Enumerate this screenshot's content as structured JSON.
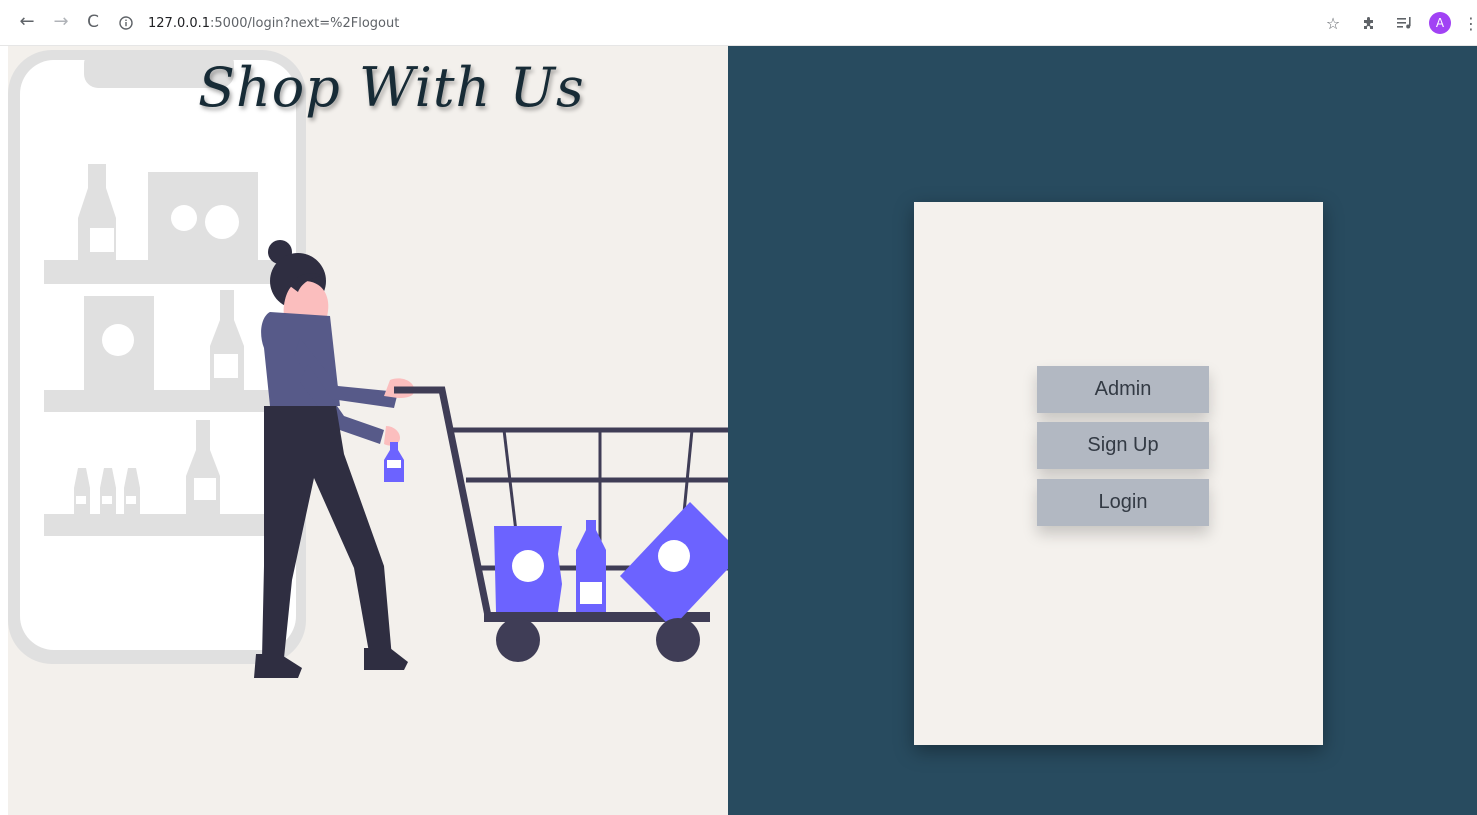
{
  "browser": {
    "url_host": "127.0.0.1",
    "url_rest": ":5000/login?next=%2Flogout",
    "nav": {
      "back": "←",
      "forward": "→",
      "reload": "C"
    },
    "extensions": {
      "star": "☆",
      "puzzle": "✱",
      "media": "≡♪",
      "avatar_letter": "A",
      "menu": "⋮"
    },
    "colors": {
      "avatar": "#a142f4"
    }
  },
  "hero": {
    "title": "Shop With Us",
    "colors": {
      "panel_bg": "#f3f0ec",
      "accent": "#6c63ff",
      "dark": "#2f2e41",
      "shirt": "#575a89",
      "shelf": "#e0e0e0"
    }
  },
  "auth": {
    "colors": {
      "bg": "#284b5f",
      "card": "#f4f1ed",
      "button": "#b2b8c2"
    },
    "buttons": {
      "admin": "Admin",
      "signup": "Sign Up",
      "login": "Login"
    }
  }
}
